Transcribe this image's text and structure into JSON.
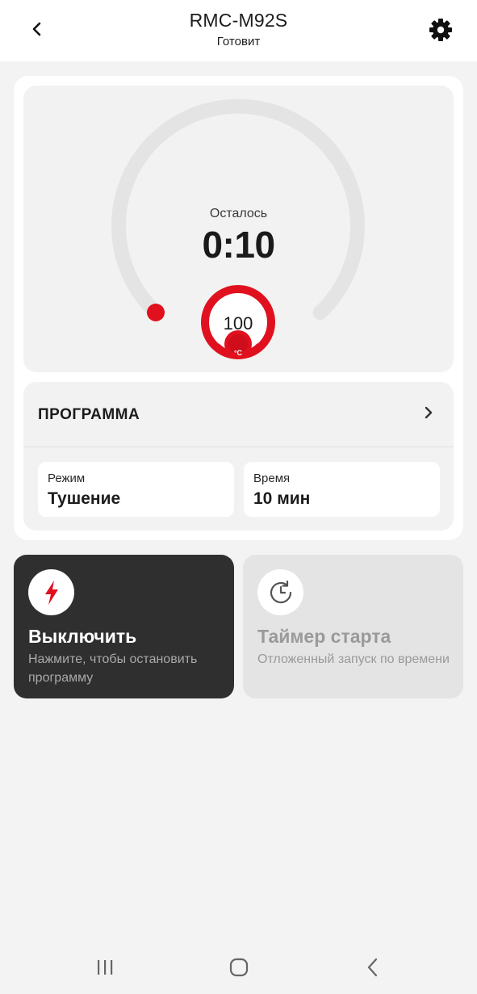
{
  "header": {
    "title": "RMC-M92S",
    "subtitle": "Готовит",
    "back_icon": "chevron-left-icon",
    "settings_icon": "gear-icon"
  },
  "dial": {
    "remaining_label": "Осталось",
    "remaining_value": "0:10",
    "temperature": "100",
    "temperature_unit": "°C",
    "progress": 0.0
  },
  "program": {
    "title": "ПРОГРАММА",
    "mode_label": "Режим",
    "mode_value": "Тушение",
    "time_label": "Время",
    "time_value": "10 мин"
  },
  "actions": {
    "off": {
      "title": "Выключить",
      "description": "Нажмите, чтобы остановить программу",
      "icon": "lightning-icon"
    },
    "timer": {
      "title": "Таймер старта",
      "description": "Отложенный запуск по времени",
      "icon": "clock-icon"
    }
  },
  "colors": {
    "accent": "#e0101e",
    "dark_card": "#2f2f2f",
    "background": "#f3f3f3"
  }
}
